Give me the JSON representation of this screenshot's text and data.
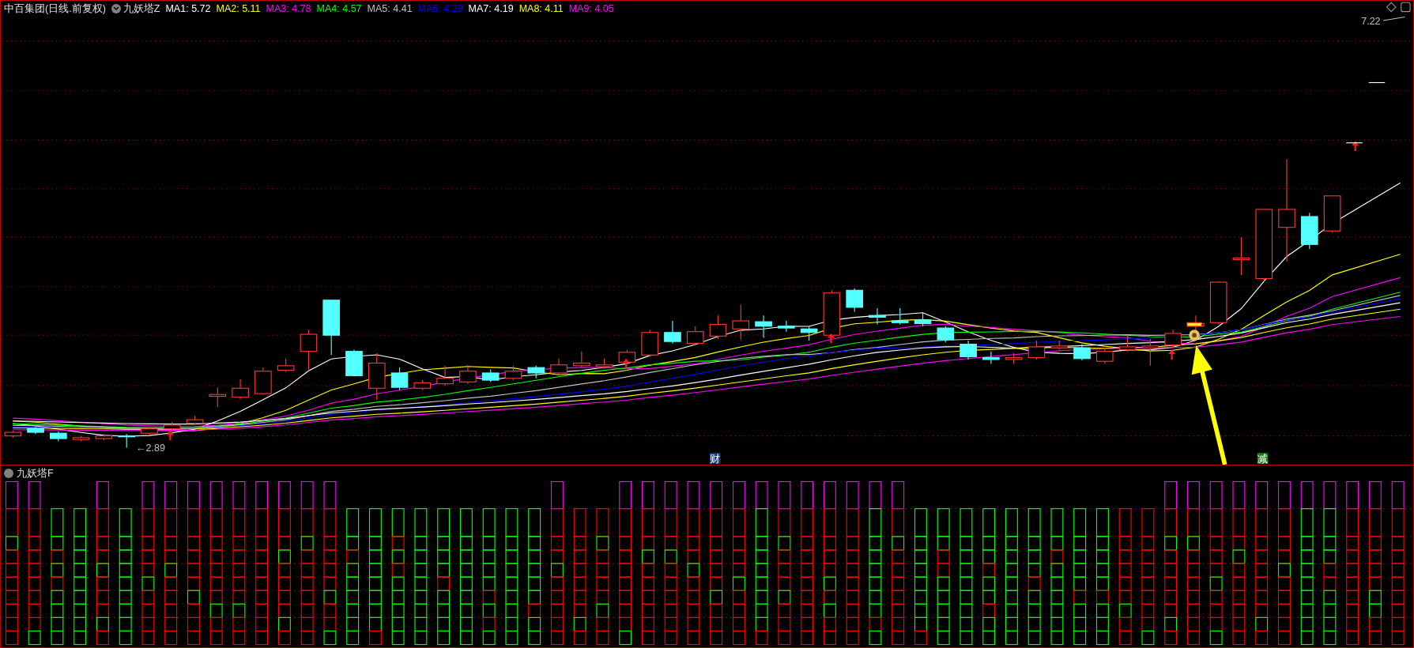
{
  "header": {
    "security": "中百集团(日线.前复权)",
    "indicator": "九妖塔Z",
    "moving_averages": [
      {
        "label": "MA1:",
        "value": "5.72",
        "color": "#ffffff"
      },
      {
        "label": "MA2:",
        "value": "5.11",
        "color": "#ffff00"
      },
      {
        "label": "MA3:",
        "value": "4.78",
        "color": "#ff00ff"
      },
      {
        "label": "MA4:",
        "value": "4.57",
        "color": "#00ff00"
      },
      {
        "label": "MA5:",
        "value": "4.41",
        "color": "#c0c0c0"
      },
      {
        "label": "MA6:",
        "value": "4.29",
        "color": "#0000ff"
      },
      {
        "label": "MA7:",
        "value": "4.19",
        "color": "#ffffff"
      },
      {
        "label": "MA8:",
        "value": "4.11",
        "color": "#ffff00"
      },
      {
        "label": "MA9:",
        "value": "4.05",
        "color": "#ff00ff"
      }
    ]
  },
  "price_chart": {
    "high_label": "7.22",
    "low_label": "←2.89",
    "signals": [
      {
        "text": "财",
        "color": "#1e3c78"
      },
      {
        "text": "减",
        "color": "#1a7a1a"
      }
    ]
  },
  "lower_panel": {
    "title": "九妖塔F"
  }
}
